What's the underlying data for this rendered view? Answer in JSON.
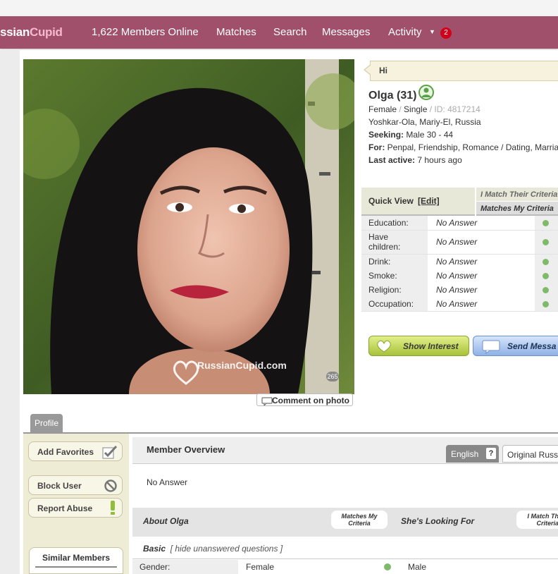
{
  "nav": {
    "logo_main": "ssian",
    "logo_accent": "Cupid",
    "online": "1,622 Members Online",
    "matches": "Matches",
    "search": "Search",
    "messages": "Messages",
    "activity": "Activity",
    "activity_caret": "▼",
    "badge": "2"
  },
  "photo": {
    "watermark": "RussianCupid.com",
    "count": "265",
    "comment_label": "Comment on photo"
  },
  "profile": {
    "greeting": "Hi",
    "name": "Olga (31)",
    "gender": "Female",
    "sep": " / ",
    "status": "Single",
    "id": "ID: 4817214",
    "location": "Yoshkar-Ola, Mariy-El, Russia",
    "seeking_label": "Seeking:",
    "seeking": "Male 30 - 44",
    "for_label": "For:",
    "for": "Penpal, Friendship, Romance / Dating, Marria",
    "active_label": "Last active:",
    "active": "7 hours ago"
  },
  "quick_view": {
    "title": "Quick View",
    "edit": "[Edit]",
    "crit_match_theirs": "I Match Their Criteria",
    "crit_matches_mine": "Matches My Criteria",
    "rows": [
      {
        "label": "Education:",
        "value": "No Answer"
      },
      {
        "label": "Have children:",
        "value": "No Answer"
      },
      {
        "label": "Drink:",
        "value": "No Answer"
      },
      {
        "label": "Smoke:",
        "value": "No Answer"
      },
      {
        "label": "Religion:",
        "value": "No Answer"
      },
      {
        "label": "Occupation:",
        "value": "No Answer"
      }
    ],
    "match_color": "#7fba6a"
  },
  "actions": {
    "interest": "Show Interest",
    "message": "Send Messa"
  },
  "tabs": {
    "profile": "Profile"
  },
  "sidebar": {
    "add_favorites": "Add Favorites",
    "block_user": "Block User",
    "report_abuse": "Report Abuse",
    "similar": "Similar Members"
  },
  "overview": {
    "title": "Member Overview",
    "lang_en": "English",
    "lang_q": "?",
    "lang_orig": "Original Russ",
    "body": "No Answer"
  },
  "about": {
    "title": "About Olga",
    "bubble_matches": "Matches My Criteria",
    "looking": "She's Looking For",
    "bubble_imatch": "I Match Th Criteria",
    "basic_label": "Basic",
    "basic_hide": "[ hide unanswered questions ]",
    "gender_label": "Gender:",
    "gender_value": "Female",
    "gender_pref": "Male"
  },
  "colors": {
    "nav_bg": "#a1506c",
    "interest_btn": "#c0d84e",
    "message_btn": "#a9c3ee",
    "sidebar_bg": "#eeecd5"
  }
}
